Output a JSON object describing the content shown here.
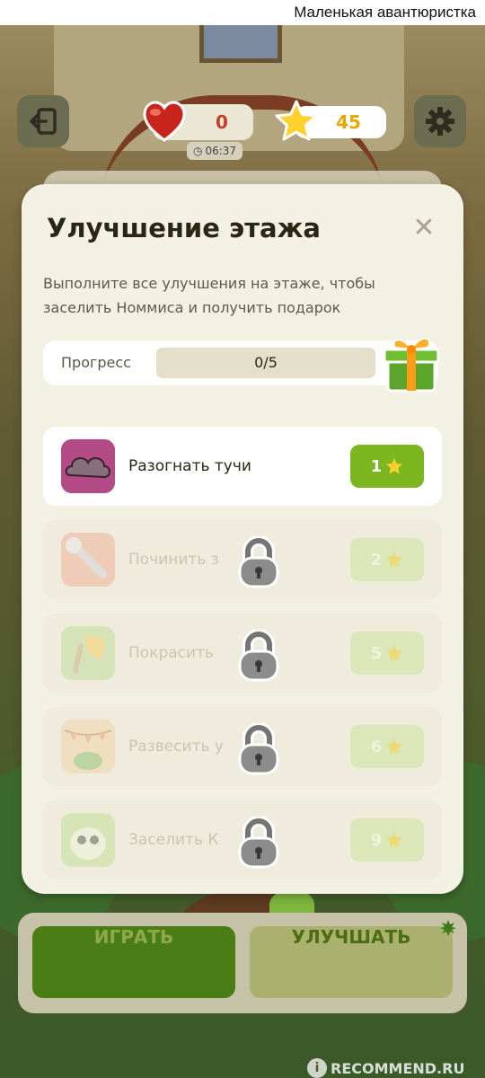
{
  "photo_caption": "Маленькая авантюристка",
  "hud": {
    "exit_icon": "exit-icon",
    "hearts_count": "0",
    "timer": "06:37",
    "stars_count": "45",
    "settings_icon": "gear-icon"
  },
  "dialog": {
    "title": "Улучшение этажа",
    "description": "Выполните все улучшения на этаже, чтобы заселить Номмиса и получить подарок",
    "progress_label": "Прогресс",
    "progress_text": "0/5",
    "progress_fraction": 0,
    "tasks": [
      {
        "label": "Разогнать тучи",
        "cost": "1",
        "locked": false,
        "icon": "cloud-icon"
      },
      {
        "label": "Починить з",
        "cost": "2",
        "locked": true,
        "icon": "wrench-icon"
      },
      {
        "label": "Покрасить",
        "cost": "5",
        "locked": true,
        "icon": "paint-brush-icon"
      },
      {
        "label": "Развесить у",
        "cost": "6",
        "locked": true,
        "icon": "garland-icon"
      },
      {
        "label": "Заселить К",
        "cost": "9",
        "locked": true,
        "icon": "om-nom-icon"
      }
    ]
  },
  "buttons": {
    "play": "ИГРАТЬ",
    "upgrade": "УЛУЧШАТЬ"
  },
  "watermark": "RECOMMEND.RU",
  "colors": {
    "accent_green": "#7cb620",
    "dialog_bg": "#f3f0e4",
    "star_text": "#e7a600",
    "heart_text": "#c23f2a"
  }
}
